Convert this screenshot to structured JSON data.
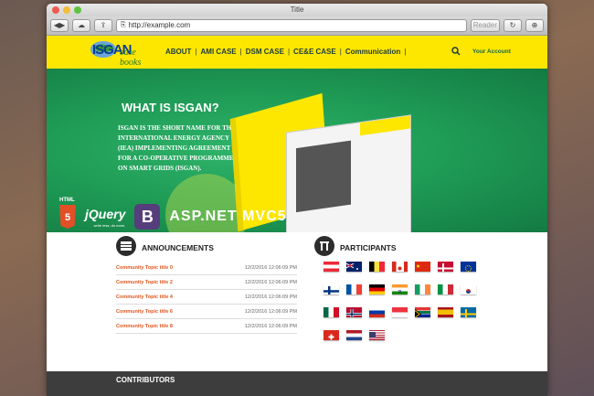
{
  "browser": {
    "title": "Title",
    "url": "http://example.com",
    "reader_label": "Reader"
  },
  "site": {
    "logo_text": "ISGAN",
    "logo_sub": "case books",
    "menu": [
      "ABOUT",
      "AMI CASE",
      "DSM CASE",
      "CE&E CASE",
      "Communication"
    ],
    "account_label": "Your Account"
  },
  "hero": {
    "title": "WHAT IS ISGAN?",
    "text": "ISGAN IS THE SHORT NAME FOR THE INTERNATIONAL ENERGY AGENCY (IEA) IMPLEMENTING AGREEMENT FOR A CO-OPERATIVE PROGRAMME ON SMART GRIDS (ISGAN).",
    "tech": {
      "html_label": "HTML",
      "html_num": "5",
      "jquery": "jQuery",
      "jquery_sub": "write less, do more.",
      "bootstrap": "B",
      "asp": "ASP.NET MVC5"
    }
  },
  "announcements": {
    "title": "ANNOUNCEMENTS",
    "items": [
      {
        "title": "Community Topic title 0",
        "date": "12/2/2016 12:06:09 PM"
      },
      {
        "title": "Community Topic title 2",
        "date": "12/2/2016 12:06:09 PM"
      },
      {
        "title": "Community Topic title 4",
        "date": "12/2/2016 12:06:09 PM"
      },
      {
        "title": "Community Topic title 6",
        "date": "12/2/2016 12:06:09 PM"
      },
      {
        "title": "Community Topic title 8",
        "date": "12/2/2016 12:06:09 PM"
      }
    ]
  },
  "participants": {
    "title": "PARTICIPANTS",
    "flags": [
      "austria",
      "australia",
      "belgium",
      "canada",
      "china",
      "denmark",
      "europe",
      "finland",
      "france",
      "germany",
      "india",
      "ireland",
      "italy",
      "korea",
      "mexico",
      "norway",
      "russia",
      "singapore",
      "south-africa",
      "spain",
      "sweden",
      "switzerland",
      "netherlands",
      "usa"
    ]
  },
  "footer": {
    "title": "CONTRIBUTORS"
  },
  "colors": {
    "nav_yellow": "#fde600",
    "hero_green": "#1e9a55",
    "accent_orange": "#e0571f"
  }
}
